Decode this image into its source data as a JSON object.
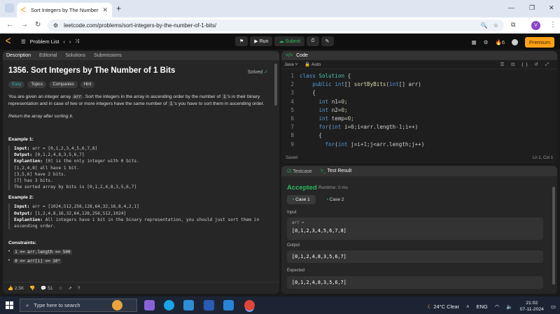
{
  "browser": {
    "tab_title": "Sort Integers by The Number of",
    "url": "leetcode.com/problems/sort-integers-by-the-number-of-1-bits/",
    "profile_initial": "V"
  },
  "header": {
    "problem_list": "Problem List",
    "run": "Run",
    "submit": "Submit",
    "streak": "6",
    "premium": "Premium"
  },
  "left_tabs": [
    "Description",
    "Editorial",
    "Solutions",
    "Submissions"
  ],
  "problem": {
    "title": "1356. Sort Integers by The Number of 1 Bits",
    "solved": "Solved",
    "tags": [
      "Easy",
      "Topics",
      "Companies",
      "Hint"
    ],
    "desc1a": "You are given an integer array ",
    "desc1_code": "arr",
    "desc1b": ". Sort the integers in the array in ascending order by the number of ",
    "desc1_code2": "1",
    "desc1c": "'s in their binary representation and in case of two or more integers have the same number of ",
    "desc1_code3": "1",
    "desc1d": "'s you have to sort them in ascending order.",
    "desc2": "Return the array after sorting it.",
    "ex1_title": "Example 1:",
    "ex1_input_label": "Input:",
    "ex1_input": " arr = [0,1,2,3,4,5,6,7,8]",
    "ex1_output_label": "Output:",
    "ex1_output": " [0,1,2,4,8,3,5,6,7]",
    "ex1_expl_label": "Explantion:",
    "ex1_expl": " [0] is the only integer with 0 bits.\n[1,2,4,8] all have 1 bit.\n[3,5,6] have 2 bits.\n[7] has 3 bits.\nThe sorted array by bits is [0,1,2,4,8,3,5,6,7]",
    "ex2_title": "Example 2:",
    "ex2_input_label": "Input:",
    "ex2_input": " arr = [1024,512,256,128,64,32,16,8,4,2,1]",
    "ex2_output_label": "Output:",
    "ex2_output": " [1,2,4,8,16,32,64,128,256,512,1024]",
    "ex2_expl_label": "Explantion:",
    "ex2_expl": " All integers have 1 bit in the binary representation, you should just sort them in\nascending order.",
    "constraints_title": "Constraints:",
    "c1": "1 <= arr.length <= 500",
    "c2": "0 <= arr[i] <= 10⁴",
    "likes": "2.5K",
    "comments": "51"
  },
  "code": {
    "title": "Code",
    "language": "Java",
    "auto": "Auto",
    "lines": [
      "class Solution {",
      "    public int[] sortByBits(int[] arr)",
      "    {",
      "      int n1=0;",
      "      int n2=0;",
      "      int temp=0;",
      "      for(int i=0;i<arr.length-1;i++)",
      "      {",
      "        for(int j=i+1;j<arr.length;j++)"
    ],
    "line_numbers": [
      "1",
      "2",
      "3",
      "4",
      "5",
      "6",
      "7",
      "8",
      "9"
    ],
    "saved": "Saved",
    "position": "Ln 1, Col 1"
  },
  "result": {
    "tab_testcase": "Testcase",
    "tab_result": "Test Result",
    "status": "Accepted",
    "runtime": "Runtime: 0 ms",
    "case1": "Case 1",
    "case2": "Case 2",
    "input_label": "Input",
    "input_var": "arr =",
    "input_value": "[0,1,2,3,4,5,6,7,8]",
    "output_label": "Output",
    "output_value": "[0,1,2,4,8,3,5,6,7]",
    "expected_label": "Expected",
    "expected_value": "[0,1,2,4,8,3,5,6,7]"
  },
  "taskbar": {
    "search": "Type here to search",
    "weather": "24°C  Clear",
    "lang": "ENG",
    "time": "21:02",
    "date": "07-11-2024"
  }
}
